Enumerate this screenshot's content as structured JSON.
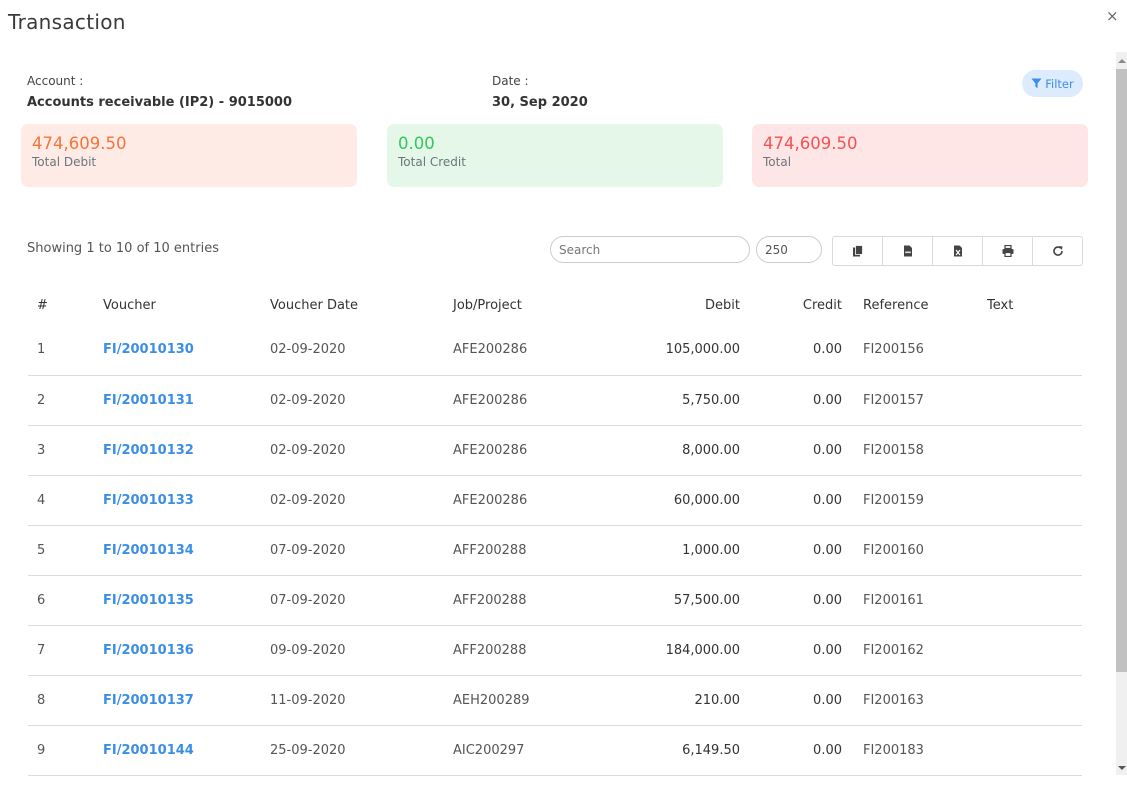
{
  "modal": {
    "title": "Transaction",
    "close_icon": "×"
  },
  "info": {
    "account_label": "Account :",
    "account_value": "Accounts receivable (IP2) - 9015000",
    "date_label": "Date :",
    "date_value": "30, Sep 2020",
    "filter_label": "Filter"
  },
  "summary": {
    "total_debit": {
      "value": "474,609.50",
      "label": "Total Debit",
      "color": "#f4743b"
    },
    "total_credit": {
      "value": "0.00",
      "label": "Total Credit",
      "color": "#34c759"
    },
    "total": {
      "value": "474,609.50",
      "label": "Total",
      "color": "#f55252"
    }
  },
  "table_controls": {
    "entries_info": "Showing 1 to 10 of 10 entries",
    "search_placeholder": "Search",
    "search_value": "",
    "page_length": "250",
    "buttons": [
      "copy-icon",
      "csv-icon",
      "excel-icon",
      "print-icon",
      "refresh-icon"
    ]
  },
  "table": {
    "columns": [
      "#",
      "Voucher",
      "Voucher Date",
      "Job/Project",
      "Debit",
      "Credit",
      "Reference",
      "Text"
    ],
    "rows": [
      {
        "idx": "1",
        "voucher": "FI/20010130",
        "date": "02-09-2020",
        "job": "AFE200286",
        "debit": "105,000.00",
        "credit": "0.00",
        "reference": "FI200156",
        "text": ""
      },
      {
        "idx": "2",
        "voucher": "FI/20010131",
        "date": "02-09-2020",
        "job": "AFE200286",
        "debit": "5,750.00",
        "credit": "0.00",
        "reference": "FI200157",
        "text": ""
      },
      {
        "idx": "3",
        "voucher": "FI/20010132",
        "date": "02-09-2020",
        "job": "AFE200286",
        "debit": "8,000.00",
        "credit": "0.00",
        "reference": "FI200158",
        "text": ""
      },
      {
        "idx": "4",
        "voucher": "FI/20010133",
        "date": "02-09-2020",
        "job": "AFE200286",
        "debit": "60,000.00",
        "credit": "0.00",
        "reference": "FI200159",
        "text": ""
      },
      {
        "idx": "5",
        "voucher": "FI/20010134",
        "date": "07-09-2020",
        "job": "AFF200288",
        "debit": "1,000.00",
        "credit": "0.00",
        "reference": "FI200160",
        "text": ""
      },
      {
        "idx": "6",
        "voucher": "FI/20010135",
        "date": "07-09-2020",
        "job": "AFF200288",
        "debit": "57,500.00",
        "credit": "0.00",
        "reference": "FI200161",
        "text": ""
      },
      {
        "idx": "7",
        "voucher": "FI/20010136",
        "date": "09-09-2020",
        "job": "AFF200288",
        "debit": "184,000.00",
        "credit": "0.00",
        "reference": "FI200162",
        "text": ""
      },
      {
        "idx": "8",
        "voucher": "FI/20010137",
        "date": "11-09-2020",
        "job": "AEH200289",
        "debit": "210.00",
        "credit": "0.00",
        "reference": "FI200163",
        "text": ""
      },
      {
        "idx": "9",
        "voucher": "FI/20010144",
        "date": "25-09-2020",
        "job": "AIC200297",
        "debit": "6,149.50",
        "credit": "0.00",
        "reference": "FI200183",
        "text": ""
      }
    ]
  },
  "colors": {
    "link": "#3b8ee6",
    "filter_bg": "#dcebfd"
  }
}
